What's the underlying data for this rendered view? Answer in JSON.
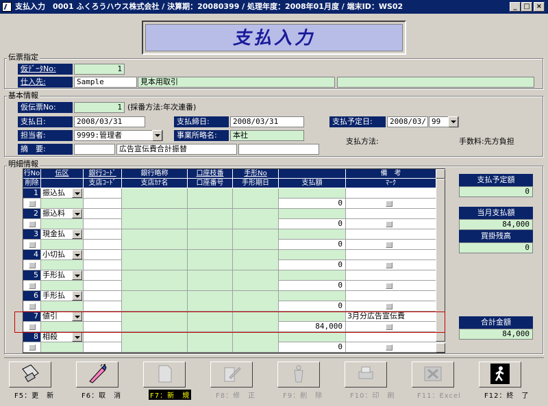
{
  "window": {
    "title": "支払入力　0001 ふくろうハウス株式会社 / 決算期：20080399 / 処理年度：2008年01月度 / 端末ID：WS02",
    "min_label": "_",
    "max_label": "□",
    "close_label": "×"
  },
  "banner": {
    "title": "支払入力"
  },
  "slip": {
    "group_label": "伝票指定",
    "temp_data_no_label": "仮ﾃﾞｰﾀNo:",
    "temp_data_no_value": "1",
    "supplier_label": "仕入先:",
    "supplier_code": "Sample",
    "supplier_name": "見本用取引",
    "supplier_extra": ""
  },
  "basic": {
    "group_label": "基本情報",
    "temp_slip_no_label": "仮伝票No:",
    "temp_slip_no_value": "1",
    "numbering_note": "(採番方法:年次連番)",
    "pay_date_label": "支払日:",
    "pay_date_value": "2008/03/31",
    "cutoff_label": "支払締日:",
    "cutoff_value": "2008/03/31",
    "planned_date_label": "支払予定日:",
    "planned_date_value": "2008/03/",
    "planned_day_value": "99",
    "staff_label": "担当者:",
    "staff_value": "9999:管理者",
    "office_label": "事業所略名:",
    "office_value": "本社",
    "summary_label": "摘　要:",
    "summary_code": "",
    "summary_text": "広告宣伝費合計振替",
    "summary_extra": "",
    "pay_method_label": "支払方法:",
    "fee_label": "手数料:先方負担"
  },
  "detail": {
    "group_label": "明細情報",
    "headers_top": [
      "行No",
      "伝区",
      "銀行ｺｰﾄﾞ",
      "銀行略称",
      "口座枝番",
      "手形No",
      "",
      "備　考"
    ],
    "headers_bottom": [
      "削除",
      "",
      "支店ｺｰﾄﾞ",
      "支店ｶﾅ名",
      "口座番号",
      "手形期日",
      "支払額",
      "ﾏｰｸ"
    ],
    "rows": [
      {
        "no": "1",
        "kind": "振込払",
        "amount": "0",
        "note": ""
      },
      {
        "no": "2",
        "kind": "振込料",
        "amount": "0",
        "note": ""
      },
      {
        "no": "3",
        "kind": "現金払",
        "amount": "0",
        "note": ""
      },
      {
        "no": "4",
        "kind": "小切払",
        "amount": "0",
        "note": ""
      },
      {
        "no": "5",
        "kind": "手形払",
        "amount": "0",
        "note": ""
      },
      {
        "no": "6",
        "kind": "手形払",
        "amount": "0",
        "note": ""
      },
      {
        "no": "7",
        "kind": "値引",
        "amount": "84,000",
        "note": "3月分広告宣伝費"
      },
      {
        "no": "8",
        "kind": "相殺",
        "amount": "0",
        "note": ""
      }
    ]
  },
  "side": {
    "planned_amount_label": "支払予定額",
    "planned_amount_value": "0",
    "monthly_label": "当月支払額",
    "monthly_value": "84,000",
    "payable_label": "買掛残高",
    "payable_value": "0",
    "total_label": "合計金額",
    "total_value": "84,000"
  },
  "fkeys": [
    {
      "label": "F5：更　新",
      "icon": "floppy-disk-icon",
      "enabled": true
    },
    {
      "label": "F6：取　消",
      "icon": "eraser-pencil-icon",
      "enabled": true
    },
    {
      "label": "F7：新　規",
      "icon": "new-document-icon",
      "enabled": false
    },
    {
      "label": "F8：修　正",
      "icon": "edit-document-icon",
      "enabled": false
    },
    {
      "label": "F9：削　除",
      "icon": "trash-icon",
      "enabled": false
    },
    {
      "label": "F10：印　刷",
      "icon": "printer-icon",
      "enabled": false
    },
    {
      "label": "F11：Excel",
      "icon": "excel-icon",
      "enabled": false
    },
    {
      "label": "F12：終　了",
      "icon": "exit-door-icon",
      "enabled": true
    }
  ],
  "colors": {
    "label_bg": "#0a246a",
    "input_green": "#d0f0d0",
    "highlight_row": "#c00000"
  }
}
